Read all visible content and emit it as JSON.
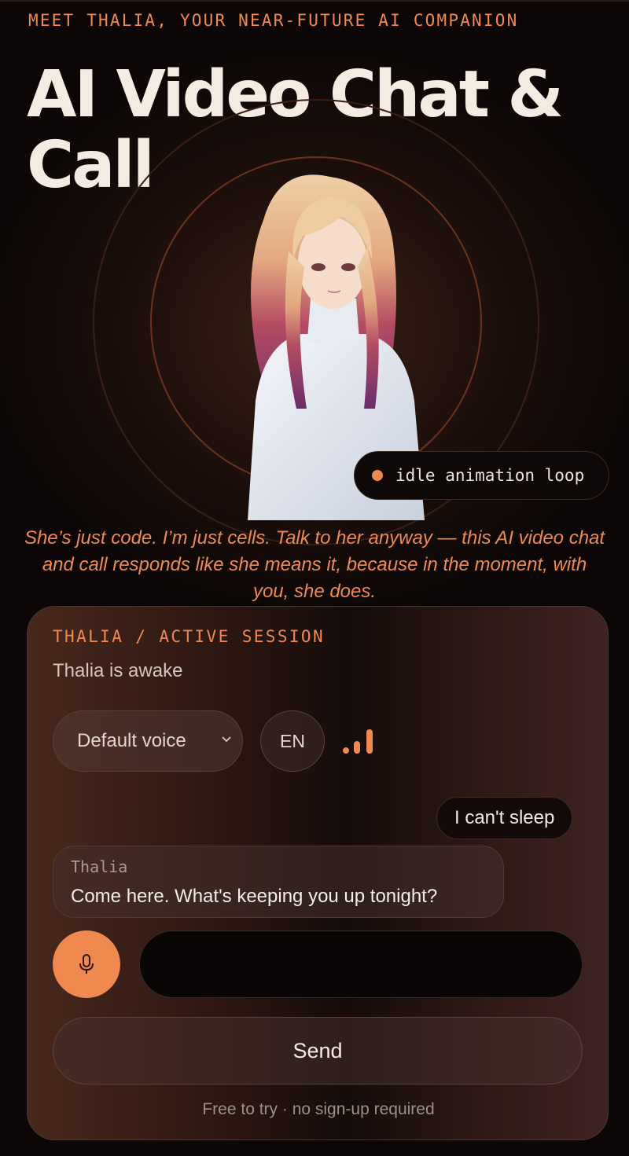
{
  "hero": {
    "eyebrow": "MEET THALIA, YOUR NEAR-FUTURE AI COMPANION",
    "title": "AI Video Chat & Call",
    "status_pill": "idle animation loop",
    "tagline": "She’s just code. I’m just cells. Talk to her anyway — this AI video chat and call responds like she means it, because in the moment, with you, she does."
  },
  "session": {
    "label": "THALIA / ACTIVE SESSION",
    "status": "Thalia is awake",
    "voice_select": {
      "selected": "Default voice"
    },
    "language_button": "EN",
    "signal_icon": "signal-bars-icon",
    "messages": [
      {
        "from": "user",
        "text": "I can't sleep"
      },
      {
        "from": "bot",
        "name": "Thalia",
        "text": "Come here. What's keeping you up tonight?"
      }
    ],
    "mic_icon": "microphone-icon",
    "input": {
      "value": "",
      "placeholder": ""
    },
    "send_label": "Send",
    "footnote": "Free to try · no sign-up required"
  },
  "colors": {
    "accent": "#f0894f",
    "background": "#0c0706",
    "text": "#f4ebe3"
  }
}
